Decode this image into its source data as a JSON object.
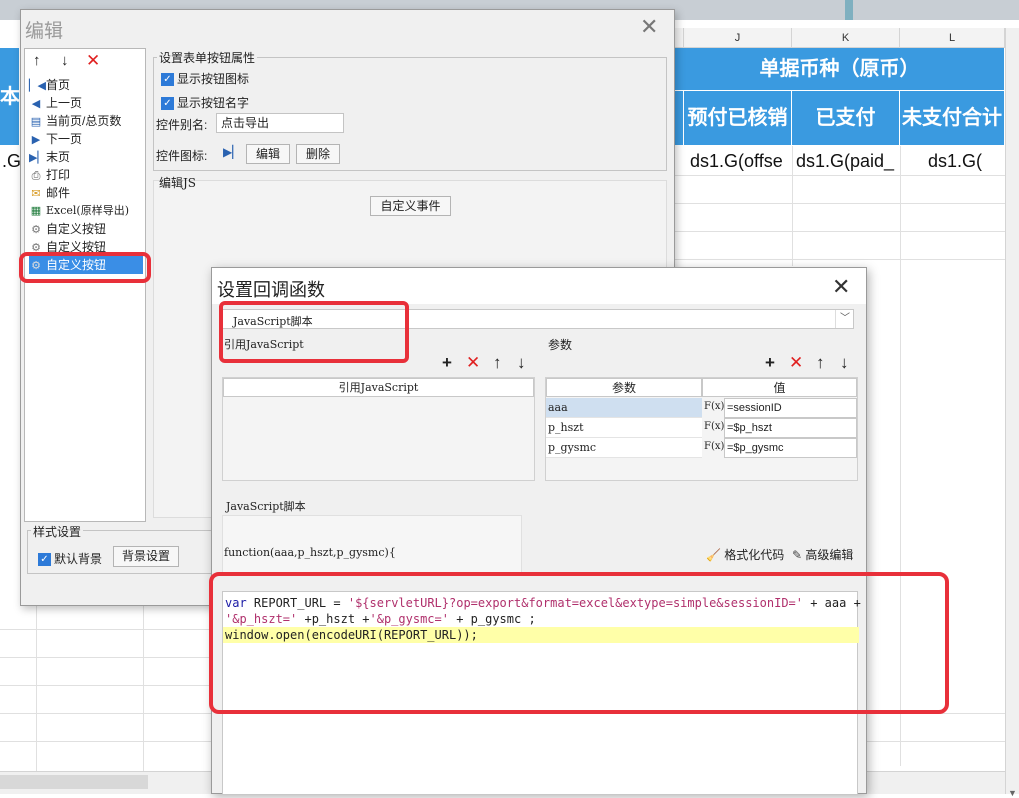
{
  "sheet": {
    "columns": [
      "J",
      "K",
      "L"
    ],
    "group_header": "单据币种（原币）",
    "header_cells": [
      "预付已核销",
      "已支付",
      "未支付合计"
    ],
    "left_header_fragment": "本体",
    "data_cells": [
      "ds1.G(offse",
      "ds1.G(paid_",
      "ds1.G("
    ],
    "left_data_fragment": ".G("
  },
  "edit_dialog": {
    "title": "编辑",
    "tree_items": [
      {
        "label": "首页",
        "icon": "first-page-icon"
      },
      {
        "label": "上一页",
        "icon": "prev-page-icon"
      },
      {
        "label": "当前页/总页数",
        "icon": "page-count-icon"
      },
      {
        "label": "下一页",
        "icon": "next-page-icon"
      },
      {
        "label": "末页",
        "icon": "last-page-icon"
      },
      {
        "label": "打印",
        "icon": "print-icon"
      },
      {
        "label": "邮件",
        "icon": "mail-icon"
      },
      {
        "label": "Excel(原样导出)",
        "icon": "excel-icon"
      },
      {
        "label": "自定义按钮",
        "icon": "gear-icon"
      },
      {
        "label": "自定义按钮",
        "icon": "gear-icon"
      },
      {
        "label": "自定义按钮",
        "icon": "gear-icon"
      }
    ],
    "props_legend": "设置表单按钮属性",
    "show_icon_label": "显示按钮图标",
    "show_name_label": "显示按钮名字",
    "alias_label": "控件别名:",
    "alias_value": "点击导出",
    "icon_label": "控件图标:",
    "edit_btn": "编辑",
    "delete_btn": "删除",
    "editjs_legend": "编辑JS",
    "custom_event_btn": "自定义事件",
    "style_legend": "样式设置",
    "default_bg_label": "默认背景",
    "bg_settings_btn": "背景设置"
  },
  "callback_dialog": {
    "title": "设置回调函数",
    "script_type": "JavaScript脚本",
    "ref_js_legend": "引用JavaScript",
    "ref_js_col": "引用JavaScript",
    "params_legend": "参数",
    "param_col": "参数",
    "value_col": "值",
    "params": [
      {
        "name": "aaa",
        "value": "=sessionID"
      },
      {
        "name": "p_hszt",
        "value": "=$p_hszt"
      },
      {
        "name": "p_gysmc",
        "value": "=$p_gysmc"
      }
    ],
    "formula_icon_text": "F(x)",
    "js_script_legend": "JavaScript脚本",
    "function_sig": "function(aaa,p_hszt,p_gysmc){",
    "format_code_label": "格式化代码",
    "advanced_edit_label": "高级编辑",
    "code": {
      "l1_kw": "var",
      "l1_a": " REPORT_URL = ",
      "l1_str": "'${servletURL}?op=export&format=excel&extype=simple&sessionID='",
      "l1_b": " + aaa +",
      "l2_str1": "'&p_hszt='",
      "l2_a": " +p_hszt +",
      "l2_str2": "'&p_gysmc='",
      "l2_b": " + p_gysmc ;",
      "l3": "window.open(encodeURI(REPORT_URL));"
    }
  },
  "colors": {
    "header_blue": "#3a9ae0",
    "selection_blue": "#3a8ee6",
    "highlight_red": "#e8303a",
    "code_highlight": "#ffffa8"
  }
}
